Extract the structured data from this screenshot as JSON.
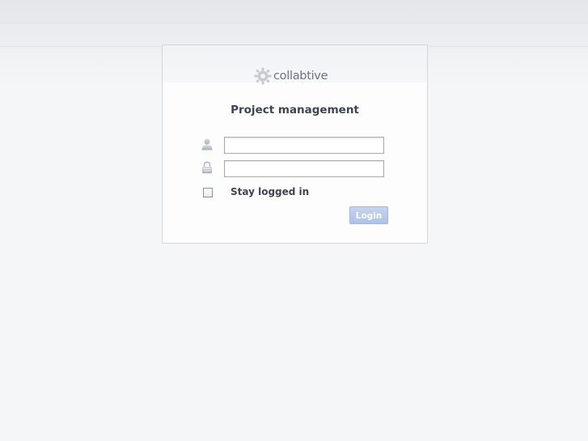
{
  "logo": {
    "text": "collabtive",
    "icon": "gear-icon"
  },
  "login_form": {
    "heading": "Project management",
    "username": {
      "icon": "user-icon",
      "value": "",
      "placeholder": ""
    },
    "password": {
      "icon": "lock-icon",
      "value": "",
      "placeholder": ""
    },
    "stay_logged_in": {
      "label": "Stay logged in",
      "checked": false
    },
    "login_button": "Login"
  },
  "colors": {
    "heading_text": "#3e4450",
    "logo_text": "#6a7486",
    "button_bg": "#b8caeb",
    "page_bg": "#f5f6f8"
  }
}
